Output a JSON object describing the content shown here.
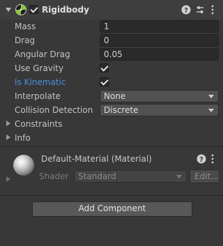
{
  "component": {
    "title": "Rigidbody",
    "enabled": true
  },
  "fields": {
    "mass": {
      "label": "Mass",
      "value": "1"
    },
    "drag": {
      "label": "Drag",
      "value": "0"
    },
    "angular_drag": {
      "label": "Angular Drag",
      "value": "0.05"
    },
    "use_gravity": {
      "label": "Use Gravity",
      "checked": true
    },
    "is_kinematic": {
      "label": "Is Kinematic",
      "checked": true
    },
    "interpolate": {
      "label": "Interpolate",
      "value": "None"
    },
    "collision_detection": {
      "label": "Collision Detection",
      "value": "Discrete"
    }
  },
  "foldouts": {
    "constraints": "Constraints",
    "info": "Info"
  },
  "material": {
    "name": "Default-Material (Material)",
    "shader_label": "Shader",
    "shader_value": "Standard",
    "edit_label": "Edit..."
  },
  "add_component_label": "Add Component",
  "colors": {
    "background": "#383838",
    "header": "#3e3e3e",
    "highlight_label": "#4c8fdd"
  }
}
